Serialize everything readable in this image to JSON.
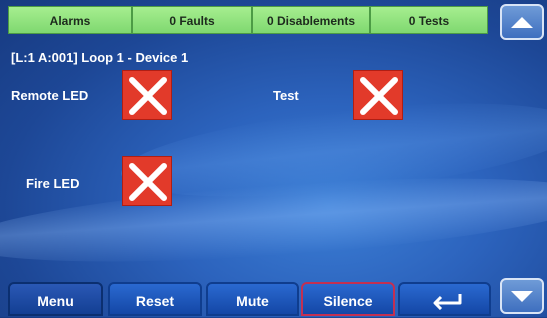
{
  "status_tabs": {
    "alarms": "Alarms",
    "faults": "0 Faults",
    "disablements": "0 Disablements",
    "tests": "0 Tests"
  },
  "device": {
    "title": "[L:1 A:001] Loop 1 - Device  1",
    "fields": {
      "remote_led": {
        "label": "Remote LED",
        "state": "off"
      },
      "test": {
        "label": "Test",
        "state": "off"
      },
      "fire_led": {
        "label": "Fire LED",
        "state": "off"
      }
    }
  },
  "bottom_buttons": {
    "menu": "Menu",
    "reset": "Reset",
    "mute": "Mute",
    "silence": "Silence"
  },
  "icons": {
    "scroll_up": "triangle-up-icon",
    "scroll_down": "triangle-down-icon",
    "enter": "enter-return-icon",
    "state_off": "x-cross-icon"
  },
  "colors": {
    "status_green": "#8ce27a",
    "state_red": "#e23a2a",
    "button_blue": "#1f5cc4",
    "silence_border": "#c23052"
  }
}
